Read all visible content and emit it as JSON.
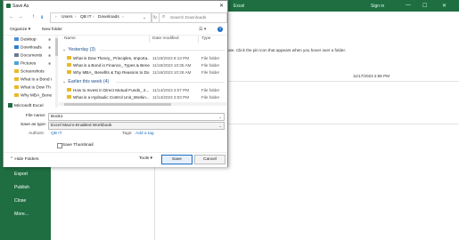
{
  "excel": {
    "app_title": "Excel",
    "signin": "Sign in",
    "window_min": "—",
    "window_max": "☐",
    "window_close": "✕",
    "sidebar_menu": [
      "Export",
      "Publish",
      "Close",
      "More..."
    ],
    "pinned_hint": "ate. Click the pin icon that appears when you hover over a folder.",
    "recent_date": "11/17/2023 2:56 PM"
  },
  "dialog": {
    "title": "Save As",
    "close": "✕",
    "nav": {
      "back": "←",
      "forward": "→",
      "up": "↑",
      "down_icon": "⬇"
    },
    "breadcrumb": [
      "Users",
      "›",
      "QB IT",
      "›",
      "Downloads",
      "›"
    ],
    "refresh": "↻",
    "search_placeholder": "Search Downloads",
    "toolbar": {
      "organize": "Organize ▾",
      "new_folder": "New folder",
      "help": "?",
      "views": "☰ ▾"
    },
    "navpane": [
      {
        "label": "Desktop",
        "color": "#4c8fd6",
        "pinned": true
      },
      {
        "label": "Downloads",
        "color": "#2e7fd2",
        "pinned": true
      },
      {
        "label": "Documents",
        "color": "#6a7b8f",
        "pinned": true
      },
      {
        "label": "Pictures",
        "color": "#4fa3d9",
        "pinned": true
      },
      {
        "label": "Screenshots",
        "color": "#e9b928",
        "pinned": false
      },
      {
        "label": "What is a Bond i",
        "color": "#e9b928",
        "pinned": false
      },
      {
        "label": "What is Dow Th",
        "color": "#e9b928",
        "pinned": false
      },
      {
        "label": "Why MBA_Bene",
        "color": "#e9b928",
        "pinned": false
      }
    ],
    "navpane_excel": "Microsoft Excel",
    "columns": {
      "name": "Name",
      "date": "Date modified",
      "type": "Type"
    },
    "groups": [
      {
        "label": "Yesterday (3)",
        "rows": [
          {
            "name": "What is Dow Theory_ Principles, Importa...",
            "date": "11/16/2023 8:13 PM",
            "type": "File folder"
          },
          {
            "name": "What is a Bond in Finance_ Types & Bene...",
            "date": "11/16/2023 10:35 AM",
            "type": "File folder"
          },
          {
            "name": "Why MBA_ Benefits & Top Reasons to Do...",
            "date": "11/16/2023 10:28 AM",
            "type": "File folder"
          }
        ]
      },
      {
        "label": "Earlier this week (4)",
        "rows": [
          {
            "name": "How to Invest in Direct Mutual Funds_ 2...",
            "date": "11/14/2023 3:07 PM",
            "type": "File folder"
          },
          {
            "name": "What is a Hydraulic Control Unit_Workin...",
            "date": "11/14/2023 3:03 PM",
            "type": "File folder"
          }
        ]
      }
    ],
    "form": {
      "file_name_label": "File name:",
      "file_name": "Book1",
      "save_type_label": "Save as type:",
      "save_type": "Excel Macro-Enabled Workbook",
      "authors_label": "Authors:",
      "authors": "QB IT",
      "tags_label": "Tags:",
      "tags": "Add a tag",
      "thumbnail": "Save Thumbnail",
      "dropdown": "⌄"
    },
    "footer": {
      "hide_folders": "Hide Folders",
      "hide_caret": "⌃",
      "tools": "Tools ▾",
      "save": "Save",
      "cancel": "Cancel"
    }
  }
}
